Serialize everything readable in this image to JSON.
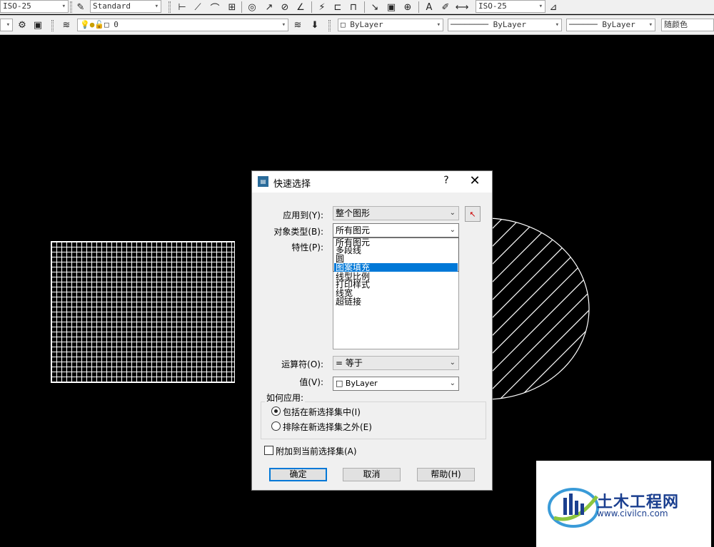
{
  "toolbar_top": {
    "dimstyle_value": "ISO-25",
    "textstyle_value": "Standard",
    "dimstyle2_value": "ISO-25"
  },
  "toolbar_layers": {
    "layer_value": "0",
    "color_value": "ByLayer",
    "linetype_value": "ByLayer",
    "lineweight_value": "ByLayer",
    "plotstyle_value": "随颜色"
  },
  "dialog": {
    "title": "快速选择",
    "help_label": "?",
    "close_label": "✕",
    "apply_to_label": "应用到(Y):",
    "apply_to_value": "整个图形",
    "object_type_label": "对象类型(B):",
    "object_type_value": "所有图元",
    "object_type_options": [
      "所有图元",
      "多段线",
      "圆",
      "图案填充"
    ],
    "properties_label": "特性(P):",
    "properties_items": [
      "线型比例",
      "打印样式",
      "线宽",
      "超链接"
    ],
    "operator_label": "运算符(O):",
    "operator_value": "= 等于",
    "value_label": "值(V):",
    "value_value": "ByLayer",
    "how_apply_title": "如何应用:",
    "include_label": "包括在新选择集中(I)",
    "exclude_label": "排除在新选择集之外(E)",
    "append_label": "附加到当前选择集(A)",
    "ok_label": "确定",
    "cancel_label": "取消",
    "help_button_label": "帮助(H)"
  },
  "watermark": {
    "name": "土木工程网",
    "url": "www.civilcn.com"
  },
  "colors": {
    "canvas": "#000000",
    "highlight": "#0078d7",
    "watermark": "#1b3f8f"
  }
}
